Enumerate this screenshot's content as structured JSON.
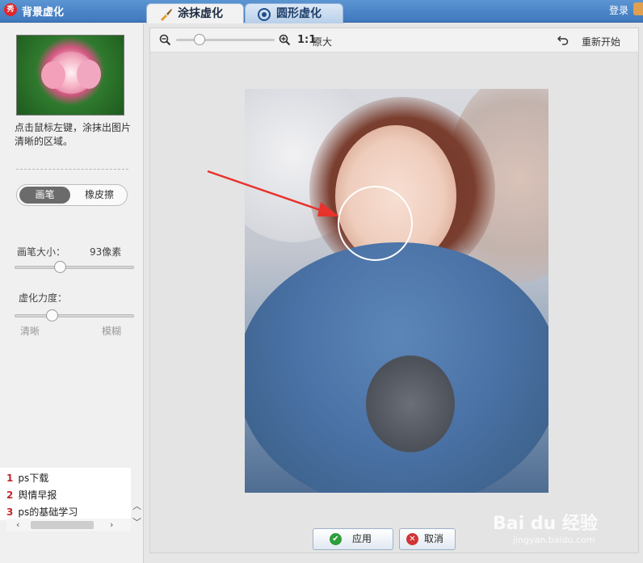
{
  "window": {
    "title": "背景虚化",
    "login": "登录"
  },
  "tabs": [
    {
      "label": "涂抹虚化",
      "active": true
    },
    {
      "label": "圆形虚化",
      "active": false
    }
  ],
  "sidebar": {
    "hint": "点击鼠标左键，涂抹出图片清晰的区域。",
    "mode": {
      "brush": "画笔",
      "eraser": "橡皮擦",
      "selected": "画笔"
    },
    "brush_size": {
      "label": "画笔大小：",
      "value": "93像素",
      "level": 0.38
    },
    "blur_strength": {
      "label": "虚化力度：",
      "min_label": "清晰",
      "max_label": "模糊",
      "level": 0.3
    },
    "hot_list": [
      {
        "rank": "1",
        "text": "ps下载"
      },
      {
        "rank": "2",
        "text": "舆情早报"
      },
      {
        "rank": "3",
        "text": "ps的基础学习"
      }
    ]
  },
  "toolbar": {
    "zoom_ratio": "1:1",
    "zoom_original_label": "原大",
    "reset_label": "重新开始"
  },
  "actions": {
    "ok": "应用",
    "cancel": "取消"
  },
  "watermark": {
    "brand": "Bai du 经验",
    "url": "jingyan.baidu.com"
  },
  "colors": {
    "title_bar": "#4a86c8",
    "accent_red": "#e0262c",
    "ok_green": "#2e9d3a",
    "cancel_red": "#d23436"
  }
}
